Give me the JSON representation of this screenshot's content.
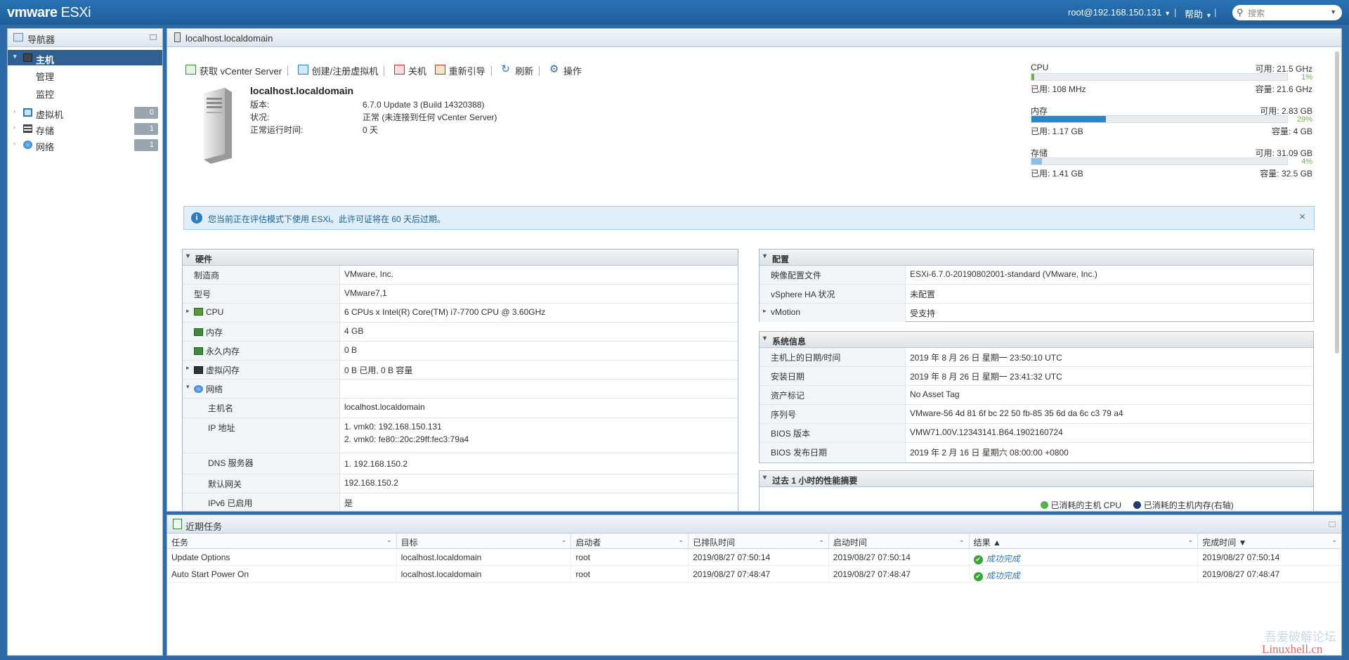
{
  "app": {
    "logo_vm": "vmware",
    "logo_product": "ESXi",
    "user": "root@192.168.150.131",
    "help": "帮助",
    "search_placeholder": "搜索"
  },
  "navigator": {
    "title": "导航器",
    "items": [
      {
        "label": "主机",
        "selected": true
      },
      {
        "label": "管理"
      },
      {
        "label": "监控"
      },
      {
        "label": "虚拟机",
        "count": "0"
      },
      {
        "label": "存储",
        "count": "1"
      },
      {
        "label": "网络",
        "count": "1"
      }
    ]
  },
  "main": {
    "title": "localhost.localdomain",
    "toolbar": [
      "获取 vCenter Server",
      "创建/注册虚拟机",
      "关机",
      "重新引导",
      "刷新",
      "操作"
    ],
    "host": {
      "name": "localhost.localdomain",
      "rows": [
        {
          "k": "版本:",
          "v": "6.7.0 Update 3 (Build 14320388)"
        },
        {
          "k": "状况:",
          "v": "正常 (未连接到任何 vCenter Server)"
        },
        {
          "k": "正常运行时间:",
          "v": "0 天"
        }
      ]
    },
    "resources": [
      {
        "name": "CPU",
        "free": "可用: 21.5 GHz",
        "pct": "1%",
        "pct_value": 1,
        "used": "已用: 108 MHz",
        "cap": "容量: 21.6 GHz",
        "color": "#6fb04f"
      },
      {
        "name": "内存",
        "free": "可用: 2.83 GB",
        "pct": "29%",
        "pct_value": 29,
        "used": "已用: 1.17 GB",
        "cap": "容量: 4 GB",
        "color": "#2a86c9"
      },
      {
        "name": "存储",
        "free": "可用: 31.09 GB",
        "pct": "4%",
        "pct_value": 4,
        "used": "已用: 1.41 GB",
        "cap": "容量: 32.5 GB",
        "color": "#8fbde3"
      }
    ],
    "alert": "您当前正在评估模式下使用 ESXi。此许可证将在 60 天后过期。",
    "hardware": {
      "title": "硬件",
      "rows": [
        {
          "k": "制造商",
          "v": "VMware, Inc."
        },
        {
          "k": "型号",
          "v": "VMware7,1"
        },
        {
          "k": "CPU",
          "v": "6 CPUs x Intel(R) Core(TM) i7-7700 CPU @ 3.60GHz"
        },
        {
          "k": "内存",
          "v": "4 GB"
        },
        {
          "k": "永久内存",
          "v": "0 B"
        },
        {
          "k": "虚拟闪存",
          "v": "0 B 已用, 0 B 容量"
        },
        {
          "k": "网络",
          "v": ""
        },
        {
          "k": "主机名",
          "v": "localhost.localdomain"
        },
        {
          "k": "IP 地址",
          "v1": "1. vmk0: 192.168.150.131",
          "v2": "2. vmk0: fe80::20c:29ff:fec3:79a4"
        },
        {
          "k": "DNS 服务器",
          "v": "1. 192.168.150.2"
        },
        {
          "k": "默认网关",
          "v": "192.168.150.2"
        },
        {
          "k": "IPv6 已启用",
          "v": "是"
        }
      ]
    },
    "config": {
      "title": "配置",
      "rows": [
        {
          "k": "映像配置文件",
          "v": "ESXi-6.7.0-20190802001-standard (VMware, Inc.)"
        },
        {
          "k": "vSphere HA 状况",
          "v": "未配置"
        },
        {
          "k": "vMotion",
          "v": "受支持"
        }
      ]
    },
    "sysinfo": {
      "title": "系统信息",
      "rows": [
        {
          "k": "主机上的日期/时间",
          "v": "2019 年 8 月 26 日 星期一 23:50:10 UTC"
        },
        {
          "k": "安装日期",
          "v": "2019 年 8 月 26 日 星期一 23:41:32 UTC"
        },
        {
          "k": "资产标记",
          "v": "No Asset Tag"
        },
        {
          "k": "序列号",
          "v": "VMware-56 4d 81 6f bc 22 50 fb-85 35 6d da 6c c3 79 a4"
        },
        {
          "k": "BIOS 版本",
          "v": "VMW71.00V.12343141.B64.1902160724"
        },
        {
          "k": "BIOS 发布日期",
          "v": "2019 年 2 月 16 日 星期六 08:00:00 +0800"
        }
      ]
    },
    "perf": {
      "title": "过去 1 小时的性能摘要",
      "legend": [
        "已消耗的主机 CPU",
        "已消耗的主机内存(右轴)"
      ]
    }
  },
  "tasks": {
    "title": "近期任务",
    "columns": [
      "任务",
      "目标",
      "启动者",
      "已排队时间",
      "启动时间",
      "结果 ▲",
      "完成时间 ▼"
    ],
    "rows": [
      [
        "Update Options",
        "localhost.localdomain",
        "root",
        "2019/08/27 07:50:14",
        "2019/08/27 07:50:14",
        "成功完成",
        "2019/08/27 07:50:14"
      ],
      [
        "Auto Start Power On",
        "localhost.localdomain",
        "root",
        "2019/08/27 07:48:47",
        "2019/08/27 07:48:47",
        "成功完成",
        "2019/08/27 07:48:47"
      ]
    ]
  },
  "watermark": [
    "吾爱破解论坛",
    "Linuxhell.cn"
  ]
}
